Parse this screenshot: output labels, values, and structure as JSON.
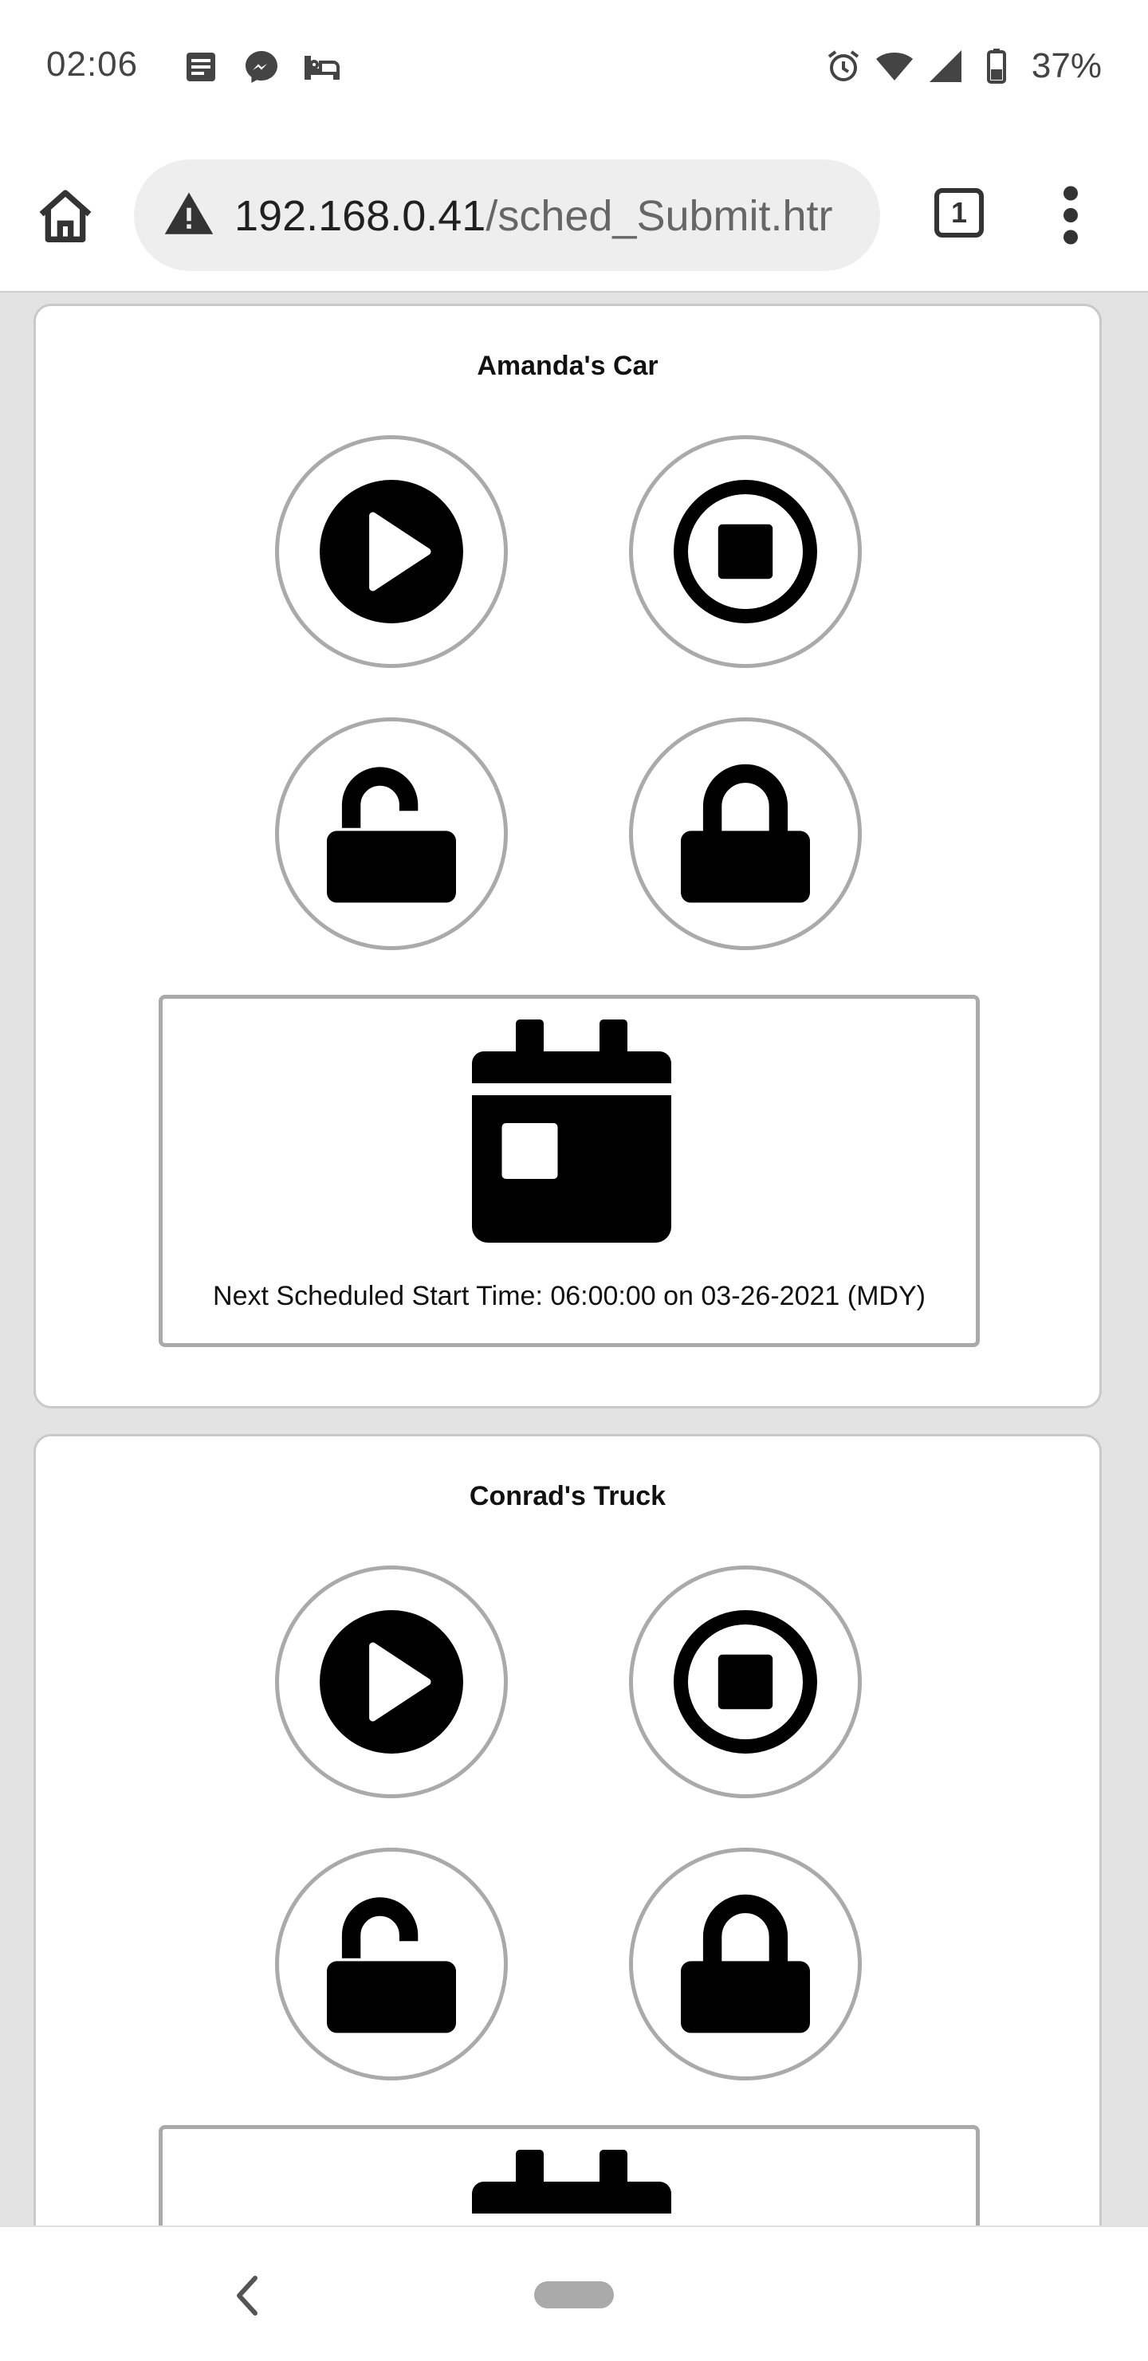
{
  "status_bar": {
    "time": "02:06",
    "notification_icons": [
      "news-icon",
      "messenger-icon",
      "bed-icon"
    ],
    "system_icons": [
      "alarm-icon",
      "wifi-icon",
      "signal-icon",
      "battery-icon"
    ],
    "battery_percent": "37%"
  },
  "browser": {
    "url_host": "192.168.0.41",
    "url_path": "/sched_Submit.htr",
    "tab_count": "1",
    "security": "not-secure-warning"
  },
  "devices": [
    {
      "name": "Amanda's Car",
      "buttons": [
        "remote-start",
        "remote-stop",
        "unlock",
        "lock"
      ],
      "schedule_text": "Next Scheduled Start Time: 06:00:00 on 03-26-2021 (MDY)"
    },
    {
      "name": "Conrad's Truck",
      "buttons": [
        "remote-start",
        "remote-stop",
        "unlock",
        "lock"
      ]
    }
  ],
  "colors": {
    "page_background": "#e2e3e2",
    "card_border": "#c9c9c9",
    "button_border": "#aaaaaa",
    "icon_fill": "#000000"
  }
}
